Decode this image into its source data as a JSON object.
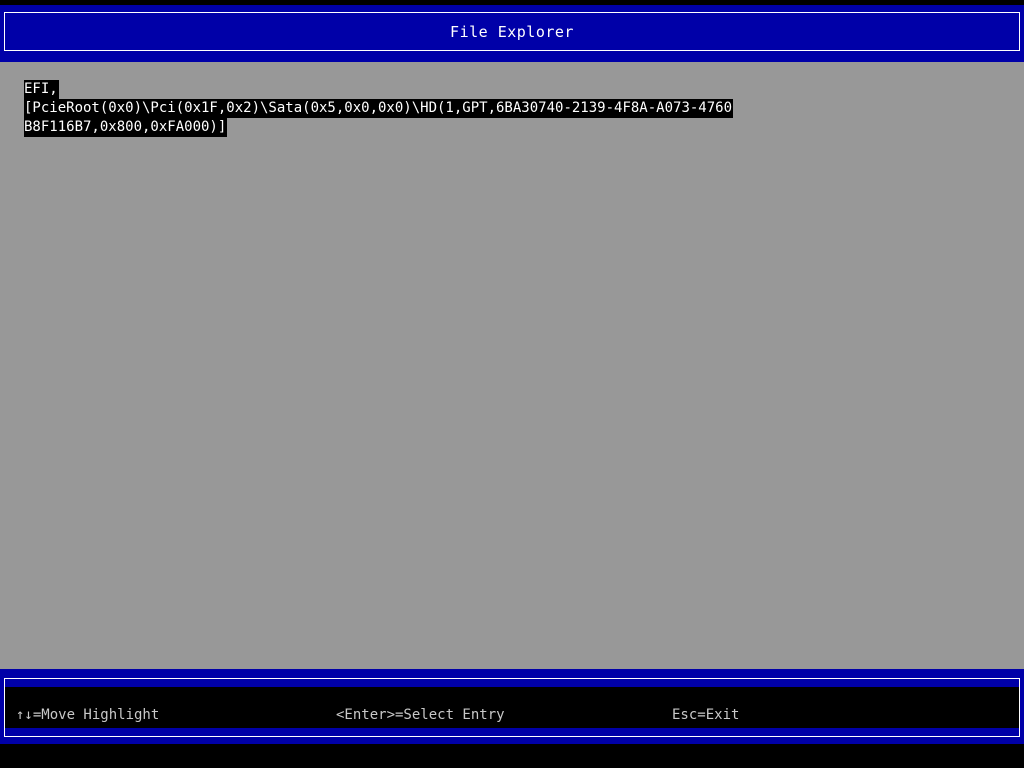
{
  "window": {
    "title": "File Explorer"
  },
  "entries": [
    {
      "lines": [
        "EFI,",
        "[PcieRoot(0x0)\\Pci(0x1F,0x2)\\Sata(0x5,0x0,0x0)\\HD(1,GPT,6BA30740-2139-4F8A-A073-4760",
        "B8F116B7,0x800,0xFA000)]"
      ],
      "highlighted": true
    }
  ],
  "footer": {
    "move_hint": "↑↓=Move Highlight",
    "select_hint": "<Enter>=Select Entry",
    "exit_hint": "Esc=Exit"
  },
  "colors": {
    "frame_blue": "#0000a8",
    "background_gray": "#989898",
    "highlight_black": "#000000",
    "text_white": "#ffffff"
  }
}
